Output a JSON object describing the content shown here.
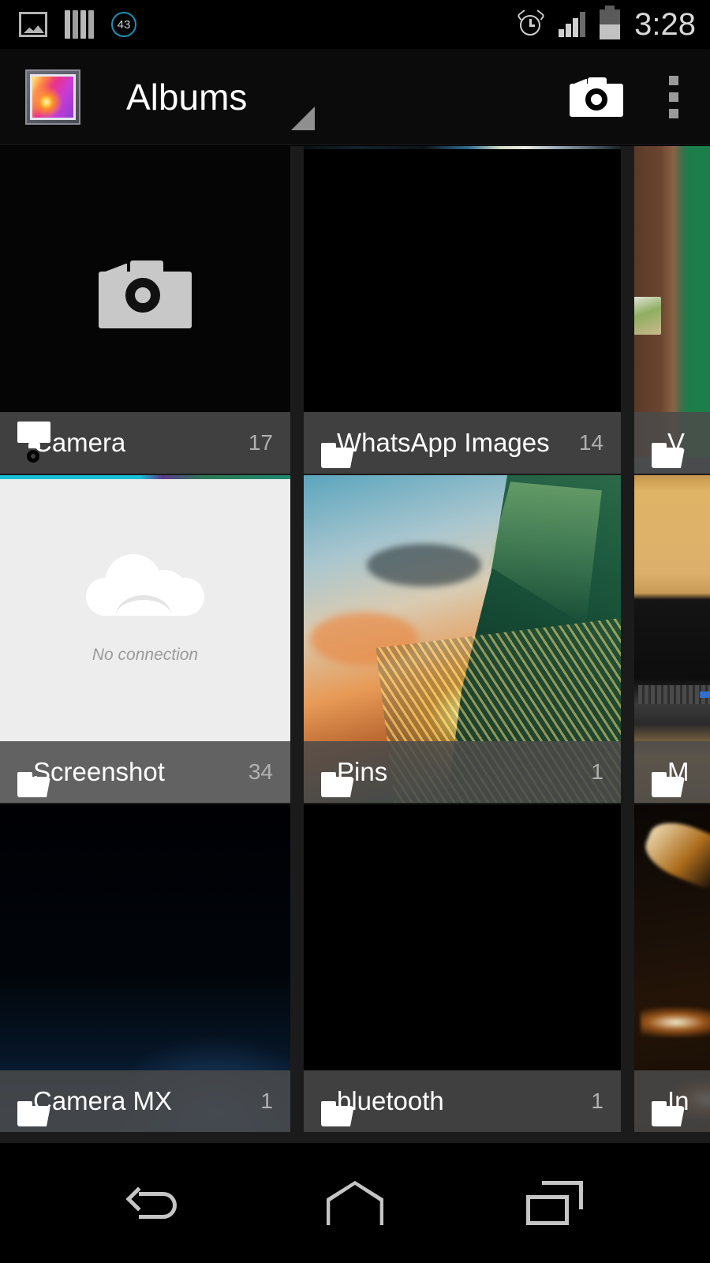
{
  "status_bar": {
    "left_icons": [
      {
        "name": "photo-icon",
        "label": "photo"
      },
      {
        "name": "stripes-icon",
        "label": "stripes"
      }
    ],
    "notification_badge": "43",
    "alarm_icon": "alarm-clock-icon",
    "signal_icon": "signal-bars-icon",
    "signal_bars_filled": 3,
    "battery_icon": "battery-icon",
    "battery_level_percent": 50,
    "time": "3:28"
  },
  "action_bar": {
    "app_icon": "gallery-app-icon",
    "title": "Albums",
    "dropdown_icon": "dropdown-triangle-icon",
    "camera_action": "camera-icon",
    "overflow_action": "overflow-menu-icon"
  },
  "albums": [
    {
      "name": "Camera",
      "count": "17",
      "icon": "camera-icon",
      "art": "art-camera-placeholder"
    },
    {
      "name": "WhatsApp Images",
      "count": "14",
      "icon": "folder-icon",
      "art": "art-whatsapp"
    },
    {
      "name": "V",
      "count": "",
      "icon": "folder-icon",
      "art": "art-green-door"
    },
    {
      "name": "Screenshot",
      "count": "34",
      "icon": "folder-icon",
      "art": "art-screenshot",
      "overlay": {
        "message": "No connection"
      }
    },
    {
      "name": "Pins",
      "count": "1",
      "icon": "folder-icon",
      "art": "art-wave"
    },
    {
      "name": "M",
      "count": "",
      "icon": "folder-icon",
      "art": "art-desk"
    },
    {
      "name": "Camera MX",
      "count": "1",
      "icon": "folder-icon",
      "art": "art-dark-blue"
    },
    {
      "name": "bluetooth",
      "count": "1",
      "icon": "folder-icon",
      "art": "art-black"
    },
    {
      "name": "In",
      "count": "",
      "icon": "folder-icon",
      "art": "art-fire"
    }
  ],
  "nav_bar": {
    "back": "back-icon",
    "home": "home-icon",
    "recents": "recents-icon"
  },
  "colors": {
    "background": "#000000",
    "action_bar": "#0b0b0b",
    "grid_gap": "#1b1b1b",
    "label_bar": "rgba(74,74,74,.86)",
    "label_text": "#ffffff",
    "count_text": "#b0b0b0",
    "badge_accent": "#1c90b5",
    "nav_icon": "#c5c5c5"
  }
}
